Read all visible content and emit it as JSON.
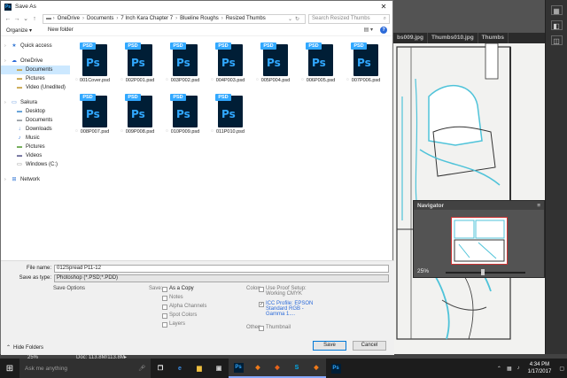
{
  "photoshop": {
    "tabs": [
      "bs009.jpg",
      "Thumbs010.jpg",
      "Thumbs"
    ],
    "navigator": {
      "title": "Navigator",
      "zoom": "25%"
    },
    "status": {
      "zoom": "25%",
      "doc": "Doc: 113.8M/113.8M"
    },
    "right_panel_icons": [
      "grid-icon",
      "layers-icon",
      "channels-icon"
    ]
  },
  "dialog": {
    "title": "Save As",
    "address": [
      "OneDrive",
      "Documents",
      "7 Inch Kara Chapter 7",
      "Blueline Roughs",
      "Resized Thumbs"
    ],
    "search_placeholder": "Search Resized Thumbs",
    "toolbar": {
      "organize": "Organize ▾",
      "new_folder": "New folder"
    },
    "nav": [
      {
        "label": "Quick access",
        "icon": "★",
        "color": "#3a7bd5",
        "level": 0,
        "gap": false,
        "sel": false
      },
      {
        "label": "OneDrive",
        "icon": "☁",
        "color": "#2b6ad9",
        "level": 0,
        "gap": true,
        "sel": false
      },
      {
        "label": "Documents",
        "icon": "▬",
        "color": "#c9a54a",
        "level": 1,
        "gap": false,
        "sel": true
      },
      {
        "label": "Pictures",
        "icon": "▬",
        "color": "#c9a54a",
        "level": 1,
        "gap": false,
        "sel": false
      },
      {
        "label": "Video (Unedited)",
        "icon": "▬",
        "color": "#c9a54a",
        "level": 1,
        "gap": false,
        "sel": false
      },
      {
        "label": "Sakura",
        "icon": "▭",
        "color": "#3a7bd5",
        "level": 0,
        "gap": true,
        "sel": false
      },
      {
        "label": "Desktop",
        "icon": "▬",
        "color": "#5b9bd5",
        "level": 1,
        "gap": false,
        "sel": false
      },
      {
        "label": "Documents",
        "icon": "▬",
        "color": "#9aa0a6",
        "level": 1,
        "gap": false,
        "sel": false
      },
      {
        "label": "Downloads",
        "icon": "↓",
        "color": "#3a7bd5",
        "level": 1,
        "gap": false,
        "sel": false
      },
      {
        "label": "Music",
        "icon": "♪",
        "color": "#3a7bd5",
        "level": 1,
        "gap": false,
        "sel": false
      },
      {
        "label": "Pictures",
        "icon": "▬",
        "color": "#6aa84f",
        "level": 1,
        "gap": false,
        "sel": false
      },
      {
        "label": "Videos",
        "icon": "▬",
        "color": "#6d6d9a",
        "level": 1,
        "gap": false,
        "sel": false
      },
      {
        "label": "Windows (C:)",
        "icon": "▭",
        "color": "#6d6d6d",
        "level": 1,
        "gap": false,
        "sel": false
      },
      {
        "label": "Network",
        "icon": "⊞",
        "color": "#3a7bd5",
        "level": 0,
        "gap": true,
        "sel": false
      }
    ],
    "files": [
      "001Cover.psd",
      "002P001.psd",
      "003P002.psd",
      "004P003.psd",
      "005P004.psd",
      "006P005.psd",
      "007P006.psd",
      "008P007.psd",
      "009P008.psd",
      "010P009.psd",
      "011P010.psd"
    ],
    "icon_tag": "PSD",
    "icon_glyph": "Ps",
    "form": {
      "file_name_label": "File name:",
      "file_name": "012Spread P11-12",
      "save_type_label": "Save as type:",
      "save_type": "Photoshop (*.PSD;*.PDD)",
      "save_options": "Save Options",
      "save_label": "Save:",
      "as_copy": "As a Copy",
      "notes": "Notes",
      "alpha": "Alpha Channels",
      "spot": "Spot Colors",
      "layers": "Layers",
      "color_label": "Color:",
      "use_proof": "Use Proof Setup:",
      "use_proof2": "Working CMYK",
      "icc": "ICC Profile: EPSON",
      "icc2": "Standard RGB -",
      "icc3": "Gamma 1....",
      "other_label": "Other:",
      "thumbnail": "Thumbnail",
      "hide_folders": "Hide Folders",
      "save_btn": "Save",
      "cancel_btn": "Cancel"
    }
  },
  "taskbar": {
    "search": "Ask me anything",
    "time": "4:34 PM",
    "date": "1/17/2017",
    "apps": [
      {
        "name": "task-view-icon",
        "glyph": "❐",
        "color": "#ffffff"
      },
      {
        "name": "edge-icon",
        "glyph": "e",
        "color": "#3b8ee6"
      },
      {
        "name": "file-explorer-icon",
        "glyph": "▆",
        "color": "#f0c040"
      },
      {
        "name": "store-icon",
        "glyph": "▣",
        "color": "#cfcfcf"
      },
      {
        "name": "photoshop-icon",
        "glyph": "Ps",
        "color": "#31a8ff"
      },
      {
        "name": "app-orange-icon",
        "glyph": "◆",
        "color": "#f07a1a"
      },
      {
        "name": "app-orange2-icon",
        "glyph": "◆",
        "color": "#e8631a"
      },
      {
        "name": "skype-icon",
        "glyph": "S",
        "color": "#00aff0"
      },
      {
        "name": "app-orange3-icon",
        "glyph": "◆",
        "color": "#f07a1a"
      },
      {
        "name": "app-ps2-icon",
        "glyph": "Ps",
        "color": "#31a8ff"
      }
    ],
    "active_apps": [
      4,
      5,
      6,
      7,
      8
    ]
  }
}
